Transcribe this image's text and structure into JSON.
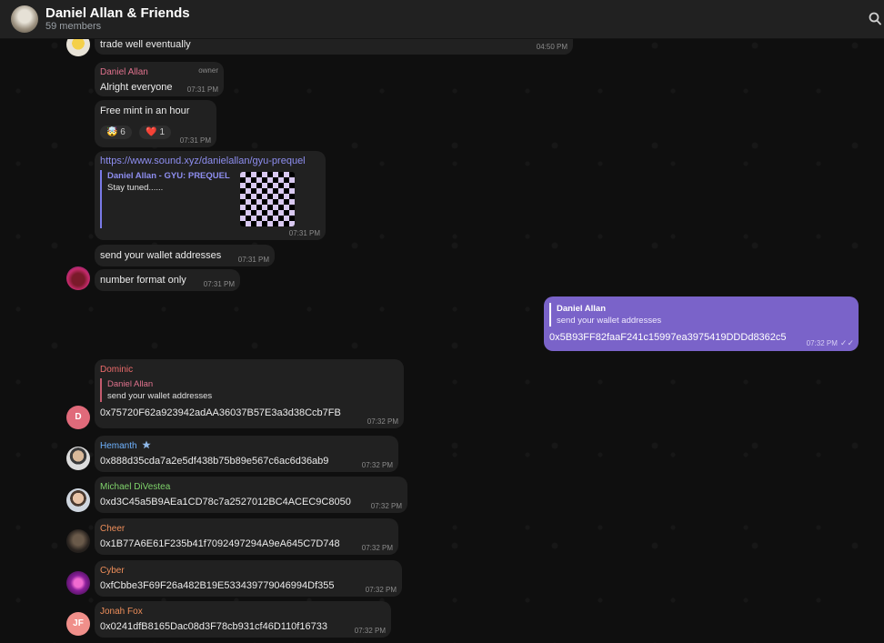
{
  "header": {
    "title": "Daniel Allan & Friends",
    "subtitle": "59 members",
    "search_icon": "search-icon"
  },
  "colors": {
    "accent": "#7a63c9",
    "bubble_in": "#212121",
    "background": "#0f0f0f",
    "name_pink": "#e0728d",
    "name_blue": "#6fb3ff",
    "name_green": "#7fd36b",
    "name_orange": "#ee8e5a",
    "name_red": "#ec6b6b",
    "name_magenta": "#e36fc8"
  },
  "messages": {
    "m1": {
      "text": "trade well eventually",
      "time": "04:50 PM"
    },
    "m2": {
      "sender": "Daniel Allan",
      "badge": "owner",
      "text": "Alright everyone",
      "time": "07:31 PM"
    },
    "m3": {
      "text": "Free mint in an hour",
      "time": "07:31 PM",
      "reactions": [
        {
          "emoji": "🤯",
          "count": "6"
        },
        {
          "emoji": "❤️",
          "count": "1"
        }
      ]
    },
    "m4": {
      "link": "https://www.sound.xyz/danielallan/gyu-prequel",
      "preview_title": "Daniel Allan - GYU: PREQUEL",
      "preview_text": "Stay tuned......",
      "time": "07:31 PM"
    },
    "m5": {
      "text": "send your wallet addresses",
      "time": "07:31 PM"
    },
    "m6": {
      "text": "number format only",
      "time": "07:31 PM"
    },
    "out": {
      "reply_name": "Daniel Allan",
      "reply_text": "send your wallet addresses",
      "text": "0x5B93FF82faaF241c15997ea3975419DDDd8362c5",
      "time": "07:32 PM",
      "ticks": "✓✓"
    },
    "dominic": {
      "sender": "Dominic",
      "reply_name": "Daniel Allan",
      "reply_text": "send your wallet addresses",
      "text": "0x75720F62a923942adAA36037B57E3a3d38Ccb7FB",
      "time": "07:32 PM",
      "avatar": "D"
    },
    "hemanth": {
      "sender": "Hemanth",
      "text": "0x888d35cda7a2e5df438b75b89e567c6ac6d36ab9",
      "time": "07:32 PM"
    },
    "michael": {
      "sender": "Michael DiVestea",
      "text": "0xd3C45a5B9AEa1CD78c7a2527012BC4ACEC9C8050",
      "time": "07:32 PM"
    },
    "cheer": {
      "sender": "Cheer",
      "text": "0x1B77A6E61F235b41f7092497294A9eA645C7D748",
      "time": "07:32 PM"
    },
    "cyber": {
      "sender": "Cyber",
      "text": "0xfCbbe3F69F26a482B19E533439779046994Df355",
      "time": "07:32 PM"
    },
    "jonah": {
      "sender": "Jonah Fox",
      "text": "0x0241dfB8165Dac08d3F78cb931cf46D110f16733",
      "time": "07:32 PM",
      "avatar": "JF"
    }
  }
}
